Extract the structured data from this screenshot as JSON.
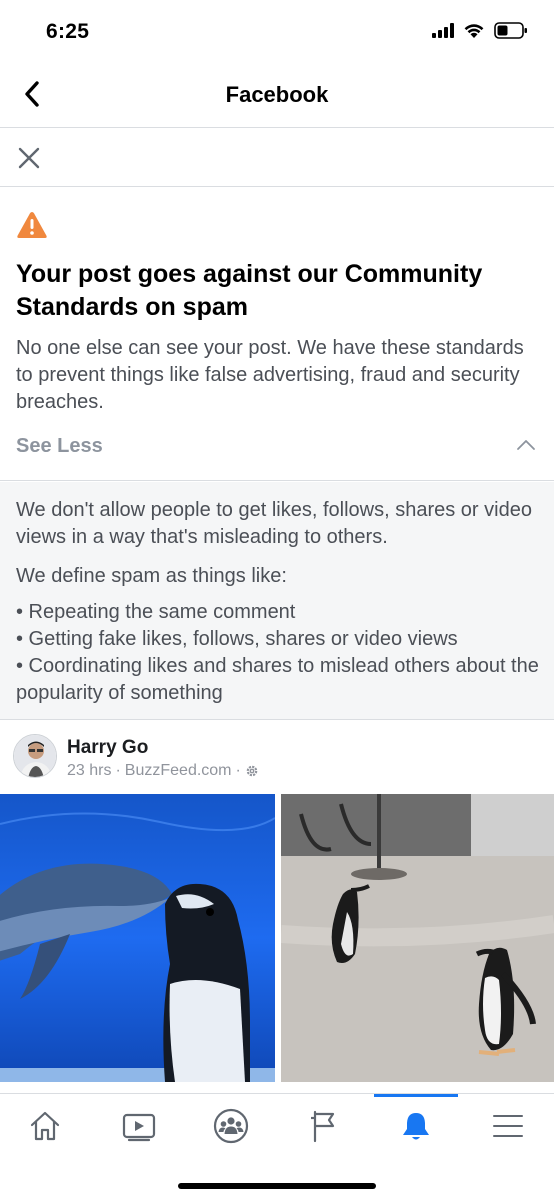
{
  "status_bar": {
    "time": "6:25"
  },
  "nav": {
    "title": "Facebook"
  },
  "warning": {
    "title": "Your post goes against our Community Standards on spam",
    "body": "No one else can see your post. We have these standards to prevent things like false advertising, fraud and security breaches.",
    "toggle_label": "See Less"
  },
  "details": {
    "paragraph1": "We don't allow people to get likes, follows, shares or video views in a way that's misleading to others.",
    "paragraph2": "We define spam as things like:",
    "items": [
      "• Repeating the same comment",
      "• Getting fake likes, follows, shares or video views",
      "• Coordinating likes and shares to mislead others about the popularity of something"
    ]
  },
  "post": {
    "author": "Harry Go",
    "time": "23 hrs",
    "separator": "·",
    "source": "BuzzFeed.com"
  },
  "tabs": [
    {
      "name": "home",
      "icon": "home-icon",
      "active": false
    },
    {
      "name": "watch",
      "icon": "video-icon",
      "active": false
    },
    {
      "name": "groups",
      "icon": "groups-icon",
      "active": false
    },
    {
      "name": "pages",
      "icon": "flag-icon",
      "active": false
    },
    {
      "name": "notifications",
      "icon": "bell-icon",
      "active": true
    },
    {
      "name": "menu",
      "icon": "menu-icon",
      "active": false
    }
  ],
  "colors": {
    "accent": "#1877f2",
    "warning": "#f0883e",
    "muted": "#8d949e"
  }
}
